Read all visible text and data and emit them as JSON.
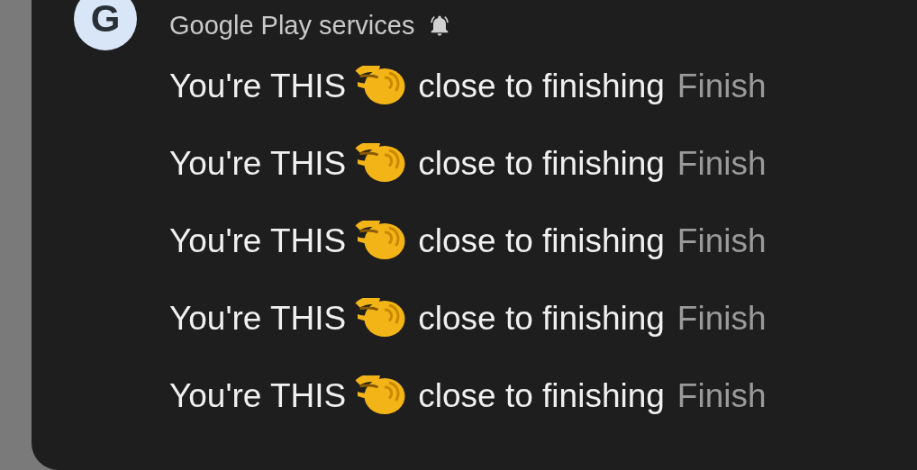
{
  "notification": {
    "app_name": "Google Play services",
    "avatar_letter": "G",
    "alerting": true,
    "messages": [
      {
        "title_start": "You're THIS",
        "title_end": "close to finishing",
        "body": "Finish"
      },
      {
        "title_start": "You're THIS",
        "title_end": "close to finishing",
        "body": "Finish"
      },
      {
        "title_start": "You're THIS",
        "title_end": "close to finishing",
        "body": "Finish"
      },
      {
        "title_start": "You're THIS",
        "title_end": "close to finishing",
        "body": "Finish"
      },
      {
        "title_start": "You're THIS",
        "title_end": "close to finishing",
        "body": "Finish"
      }
    ]
  }
}
